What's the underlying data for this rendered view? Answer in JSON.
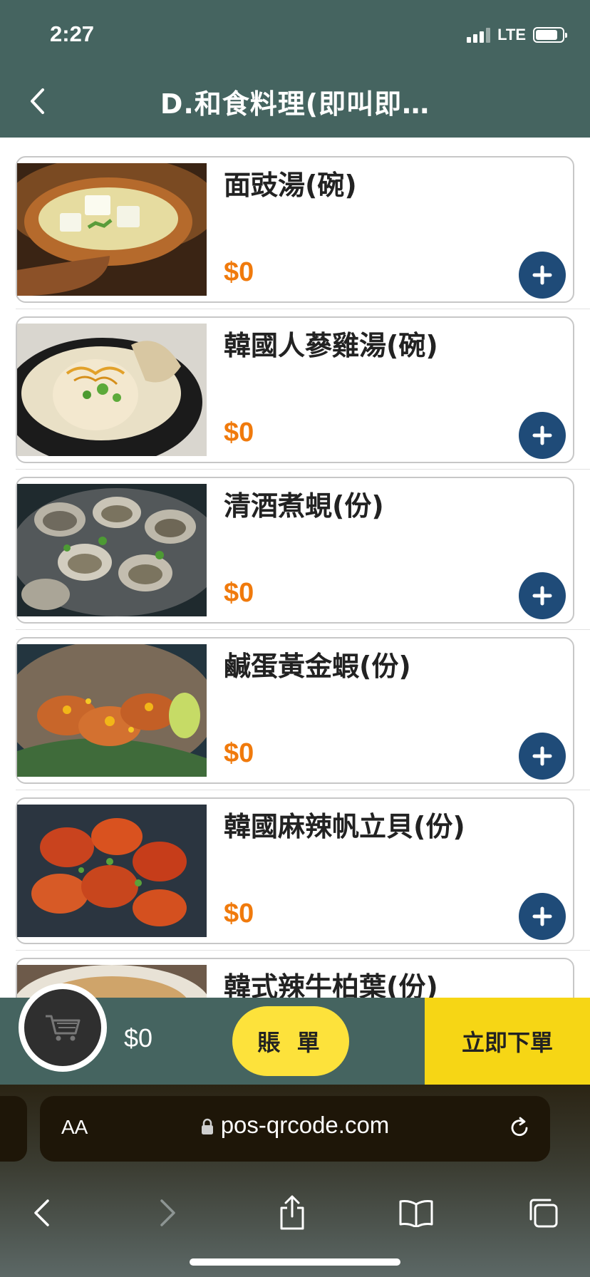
{
  "status_bar": {
    "time": "2:27",
    "network": "LTE"
  },
  "header": {
    "title": "D.和食料理(即叫即…"
  },
  "menu_items": [
    {
      "name": "面豉湯(碗)",
      "price": "$0",
      "image": "miso-soup-photo"
    },
    {
      "name": "韓國人蔘雞湯(碗)",
      "price": "$0",
      "image": "ginseng-chicken-soup-photo"
    },
    {
      "name": "清酒煮蜆(份)",
      "price": "$0",
      "image": "sake-clams-photo"
    },
    {
      "name": "鹹蛋黃金蝦(份)",
      "price": "$0",
      "image": "salted-egg-shrimp-photo"
    },
    {
      "name": "韓國麻辣帆立貝(份)",
      "price": "$0",
      "image": "spicy-scallops-photo"
    },
    {
      "name": "韓式辣牛柏葉(份)",
      "price": "",
      "image": "spicy-tripe-photo"
    }
  ],
  "order_bar": {
    "total": "$0",
    "bill_label": "賬 單",
    "order_label": "立即下單"
  },
  "browser": {
    "text_size_label": "AA",
    "url": "pos-qrcode.com"
  },
  "colors": {
    "header": "#456460",
    "price": "#f07a0c",
    "add_button": "#1f4b78",
    "bill_button": "#fde23b",
    "order_button": "#f6d615"
  }
}
